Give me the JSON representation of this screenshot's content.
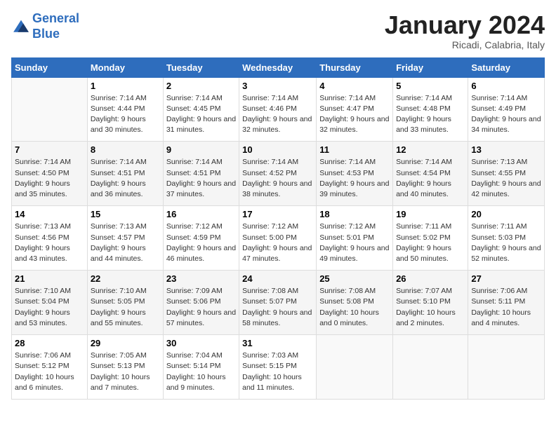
{
  "logo": {
    "line1": "General",
    "line2": "Blue"
  },
  "title": "January 2024",
  "subtitle": "Ricadi, Calabria, Italy",
  "weekdays": [
    "Sunday",
    "Monday",
    "Tuesday",
    "Wednesday",
    "Thursday",
    "Friday",
    "Saturday"
  ],
  "weeks": [
    [
      {
        "day": "",
        "sunrise": "",
        "sunset": "",
        "daylight": ""
      },
      {
        "day": "1",
        "sunrise": "Sunrise: 7:14 AM",
        "sunset": "Sunset: 4:44 PM",
        "daylight": "Daylight: 9 hours and 30 minutes."
      },
      {
        "day": "2",
        "sunrise": "Sunrise: 7:14 AM",
        "sunset": "Sunset: 4:45 PM",
        "daylight": "Daylight: 9 hours and 31 minutes."
      },
      {
        "day": "3",
        "sunrise": "Sunrise: 7:14 AM",
        "sunset": "Sunset: 4:46 PM",
        "daylight": "Daylight: 9 hours and 32 minutes."
      },
      {
        "day": "4",
        "sunrise": "Sunrise: 7:14 AM",
        "sunset": "Sunset: 4:47 PM",
        "daylight": "Daylight: 9 hours and 32 minutes."
      },
      {
        "day": "5",
        "sunrise": "Sunrise: 7:14 AM",
        "sunset": "Sunset: 4:48 PM",
        "daylight": "Daylight: 9 hours and 33 minutes."
      },
      {
        "day": "6",
        "sunrise": "Sunrise: 7:14 AM",
        "sunset": "Sunset: 4:49 PM",
        "daylight": "Daylight: 9 hours and 34 minutes."
      }
    ],
    [
      {
        "day": "7",
        "sunrise": "Sunrise: 7:14 AM",
        "sunset": "Sunset: 4:50 PM",
        "daylight": "Daylight: 9 hours and 35 minutes."
      },
      {
        "day": "8",
        "sunrise": "Sunrise: 7:14 AM",
        "sunset": "Sunset: 4:51 PM",
        "daylight": "Daylight: 9 hours and 36 minutes."
      },
      {
        "day": "9",
        "sunrise": "Sunrise: 7:14 AM",
        "sunset": "Sunset: 4:51 PM",
        "daylight": "Daylight: 9 hours and 37 minutes."
      },
      {
        "day": "10",
        "sunrise": "Sunrise: 7:14 AM",
        "sunset": "Sunset: 4:52 PM",
        "daylight": "Daylight: 9 hours and 38 minutes."
      },
      {
        "day": "11",
        "sunrise": "Sunrise: 7:14 AM",
        "sunset": "Sunset: 4:53 PM",
        "daylight": "Daylight: 9 hours and 39 minutes."
      },
      {
        "day": "12",
        "sunrise": "Sunrise: 7:14 AM",
        "sunset": "Sunset: 4:54 PM",
        "daylight": "Daylight: 9 hours and 40 minutes."
      },
      {
        "day": "13",
        "sunrise": "Sunrise: 7:13 AM",
        "sunset": "Sunset: 4:55 PM",
        "daylight": "Daylight: 9 hours and 42 minutes."
      }
    ],
    [
      {
        "day": "14",
        "sunrise": "Sunrise: 7:13 AM",
        "sunset": "Sunset: 4:56 PM",
        "daylight": "Daylight: 9 hours and 43 minutes."
      },
      {
        "day": "15",
        "sunrise": "Sunrise: 7:13 AM",
        "sunset": "Sunset: 4:57 PM",
        "daylight": "Daylight: 9 hours and 44 minutes."
      },
      {
        "day": "16",
        "sunrise": "Sunrise: 7:12 AM",
        "sunset": "Sunset: 4:59 PM",
        "daylight": "Daylight: 9 hours and 46 minutes."
      },
      {
        "day": "17",
        "sunrise": "Sunrise: 7:12 AM",
        "sunset": "Sunset: 5:00 PM",
        "daylight": "Daylight: 9 hours and 47 minutes."
      },
      {
        "day": "18",
        "sunrise": "Sunrise: 7:12 AM",
        "sunset": "Sunset: 5:01 PM",
        "daylight": "Daylight: 9 hours and 49 minutes."
      },
      {
        "day": "19",
        "sunrise": "Sunrise: 7:11 AM",
        "sunset": "Sunset: 5:02 PM",
        "daylight": "Daylight: 9 hours and 50 minutes."
      },
      {
        "day": "20",
        "sunrise": "Sunrise: 7:11 AM",
        "sunset": "Sunset: 5:03 PM",
        "daylight": "Daylight: 9 hours and 52 minutes."
      }
    ],
    [
      {
        "day": "21",
        "sunrise": "Sunrise: 7:10 AM",
        "sunset": "Sunset: 5:04 PM",
        "daylight": "Daylight: 9 hours and 53 minutes."
      },
      {
        "day": "22",
        "sunrise": "Sunrise: 7:10 AM",
        "sunset": "Sunset: 5:05 PM",
        "daylight": "Daylight: 9 hours and 55 minutes."
      },
      {
        "day": "23",
        "sunrise": "Sunrise: 7:09 AM",
        "sunset": "Sunset: 5:06 PM",
        "daylight": "Daylight: 9 hours and 57 minutes."
      },
      {
        "day": "24",
        "sunrise": "Sunrise: 7:08 AM",
        "sunset": "Sunset: 5:07 PM",
        "daylight": "Daylight: 9 hours and 58 minutes."
      },
      {
        "day": "25",
        "sunrise": "Sunrise: 7:08 AM",
        "sunset": "Sunset: 5:08 PM",
        "daylight": "Daylight: 10 hours and 0 minutes."
      },
      {
        "day": "26",
        "sunrise": "Sunrise: 7:07 AM",
        "sunset": "Sunset: 5:10 PM",
        "daylight": "Daylight: 10 hours and 2 minutes."
      },
      {
        "day": "27",
        "sunrise": "Sunrise: 7:06 AM",
        "sunset": "Sunset: 5:11 PM",
        "daylight": "Daylight: 10 hours and 4 minutes."
      }
    ],
    [
      {
        "day": "28",
        "sunrise": "Sunrise: 7:06 AM",
        "sunset": "Sunset: 5:12 PM",
        "daylight": "Daylight: 10 hours and 6 minutes."
      },
      {
        "day": "29",
        "sunrise": "Sunrise: 7:05 AM",
        "sunset": "Sunset: 5:13 PM",
        "daylight": "Daylight: 10 hours and 7 minutes."
      },
      {
        "day": "30",
        "sunrise": "Sunrise: 7:04 AM",
        "sunset": "Sunset: 5:14 PM",
        "daylight": "Daylight: 10 hours and 9 minutes."
      },
      {
        "day": "31",
        "sunrise": "Sunrise: 7:03 AM",
        "sunset": "Sunset: 5:15 PM",
        "daylight": "Daylight: 10 hours and 11 minutes."
      },
      {
        "day": "",
        "sunrise": "",
        "sunset": "",
        "daylight": ""
      },
      {
        "day": "",
        "sunrise": "",
        "sunset": "",
        "daylight": ""
      },
      {
        "day": "",
        "sunrise": "",
        "sunset": "",
        "daylight": ""
      }
    ]
  ]
}
